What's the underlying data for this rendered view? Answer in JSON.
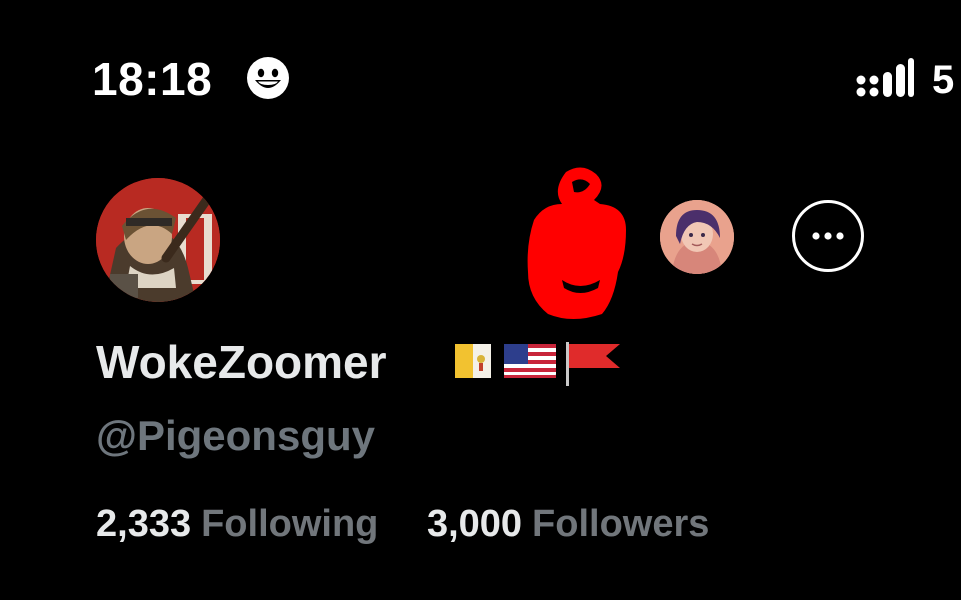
{
  "status_bar": {
    "time": "18:18",
    "battery": "5",
    "face_icon": "grinning-face-icon",
    "signal_icon": "signal-bars-icon"
  },
  "profile": {
    "display_name": "WokeZoomer",
    "handle": "@Pigeonsguy",
    "name_flags": [
      "vatican-flag-icon",
      "us-flag-icon",
      "red-flag-icon"
    ],
    "following_count": "2,333",
    "following_label": "Following",
    "followers_count": "3,000",
    "followers_label": "Followers"
  },
  "colors": {
    "background": "#000000",
    "primary_text": "#e7e9ea",
    "secondary_text": "#71767b",
    "scribble": "#ff0000"
  }
}
